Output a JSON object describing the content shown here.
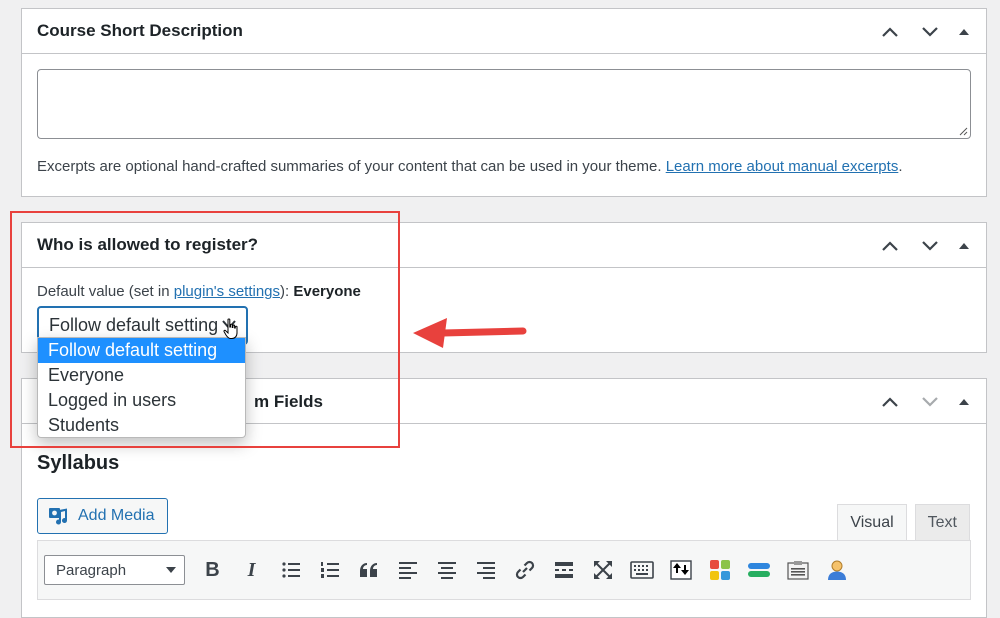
{
  "desc_box": {
    "title": "Course Short Description",
    "textarea_value": "",
    "help_text": "Excerpts are optional hand-crafted summaries of your content that can be used in your theme.",
    "help_link": "Learn more about manual excerpts",
    "help_end": "."
  },
  "register_box": {
    "title": "Who is allowed to register?",
    "default_prefix": "Default value (set in ",
    "default_link": "plugin's settings",
    "default_suffix": "): ",
    "default_value": "Everyone",
    "selected": "Follow default setting",
    "options": [
      "Follow default setting",
      "Everyone",
      "Logged in users",
      "Students"
    ]
  },
  "fields_box": {
    "title_visible_part": "m Fields",
    "syllabus_label": "Syllabus",
    "add_media_label": "Add Media",
    "tabs": [
      "Visual",
      "Text"
    ],
    "format_select": "Paragraph"
  },
  "colors": {
    "accent": "#2271b1",
    "highlight": "#e8413d",
    "dropdown_selected": "#1e90ff"
  }
}
